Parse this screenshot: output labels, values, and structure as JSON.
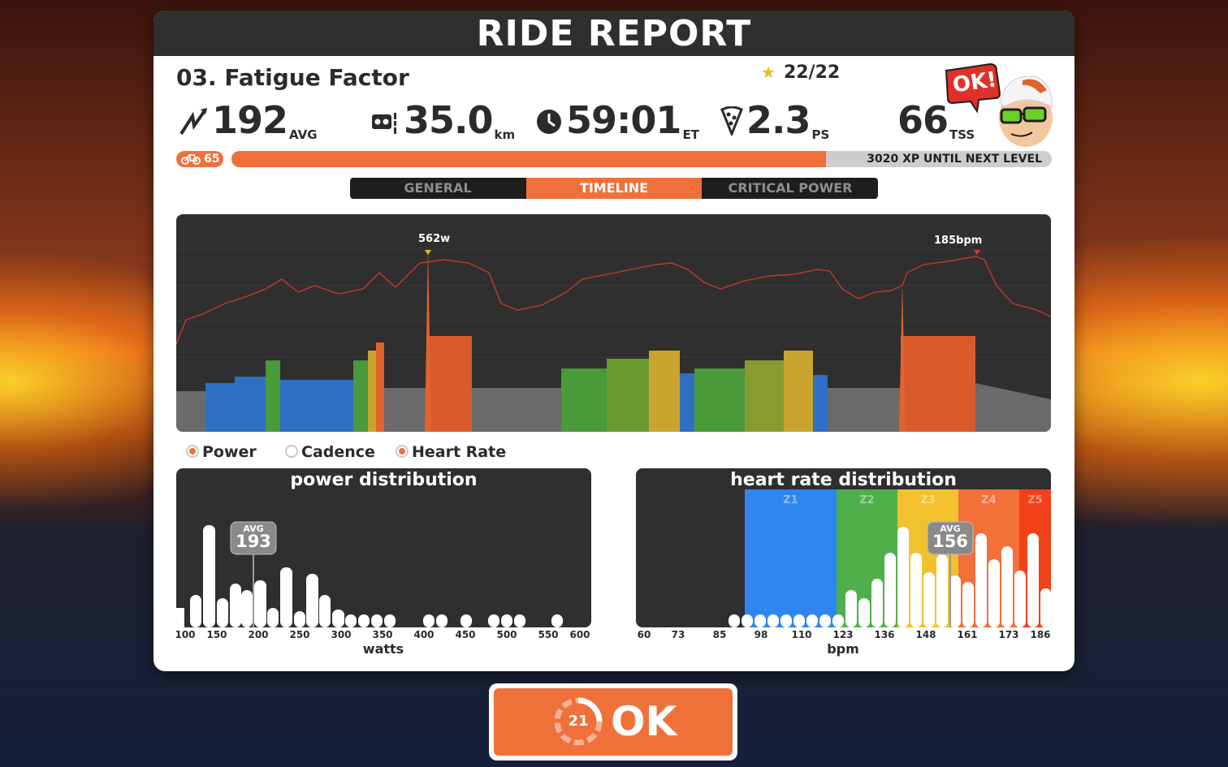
{
  "header": {
    "title": "RIDE REPORT"
  },
  "workout": {
    "name": "03. Fatigue Factor",
    "stars": "22/22"
  },
  "stats": {
    "power": {
      "value": "192",
      "unit": "AVG",
      "icon": "power-bolt-icon"
    },
    "distance": {
      "value": "35.0",
      "unit": "km",
      "icon": "road-distance-icon"
    },
    "time": {
      "value": "59:01",
      "unit": "ET",
      "icon": "clock-icon"
    },
    "pizza": {
      "value": "2.3",
      "unit": "PS",
      "icon": "pizza-slice-icon"
    },
    "tss": {
      "value": "66",
      "unit": "TSS"
    }
  },
  "level": {
    "number": "65",
    "xp_text": "3020 XP UNTIL NEXT LEVEL",
    "progress": 0.725
  },
  "avatar": {
    "bubble": "OK!"
  },
  "tabs": [
    {
      "label": "GENERAL",
      "active": false
    },
    {
      "label": "TIMELINE",
      "active": true
    },
    {
      "label": "CRITICAL POWER",
      "active": false
    }
  ],
  "timeline": {
    "power_peak": "562w",
    "hr_peak": "185bpm"
  },
  "legend": {
    "power": "Power",
    "cadence": "Cadence",
    "heart_rate": "Heart Rate"
  },
  "power_dist": {
    "title": "power distribution",
    "avg_label": "AVG",
    "avg_value": "193",
    "unit": "watts",
    "ticks": [
      "100",
      "150",
      "200",
      "250",
      "300",
      "350",
      "400",
      "450",
      "500",
      "550",
      "600"
    ]
  },
  "hr_dist": {
    "title": "heart rate distribution",
    "avg_label": "AVG",
    "avg_value": "156",
    "unit": "bpm",
    "ticks": [
      "60",
      "73",
      "85",
      "98",
      "110",
      "123",
      "136",
      "148",
      "161",
      "173",
      "186"
    ],
    "zones": [
      "Z1",
      "Z2",
      "Z3",
      "Z4",
      "Z5"
    ]
  },
  "ok_button": {
    "label": "OK",
    "countdown": "21"
  },
  "colors": {
    "orange": "#f0703a",
    "dark": "#2f2f2f",
    "z1_blue": "#2f6fc4",
    "z2_green": "#4a9a3a",
    "z3_yellow": "#c9a530",
    "z4_orange": "#e0652c",
    "z5_red": "#e03a1a",
    "gray": "#6b6b6b"
  }
}
